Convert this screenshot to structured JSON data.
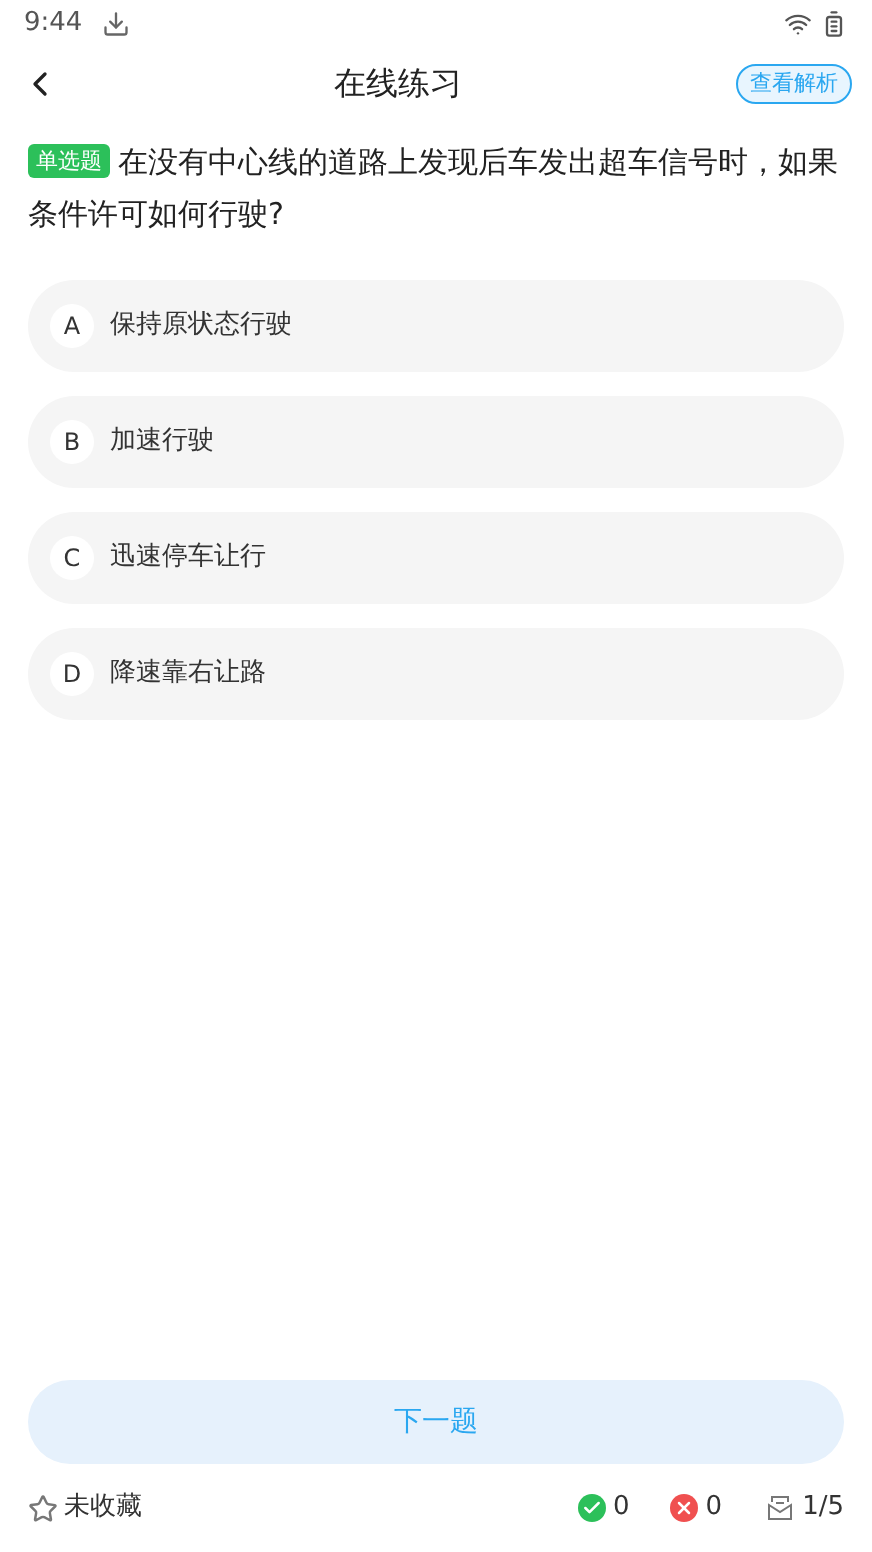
{
  "status_bar": {
    "time": "9:44"
  },
  "header": {
    "title": "在线练习",
    "action": "查看解析"
  },
  "question": {
    "type_tag": "单选题",
    "text": "在没有中心线的道路上发现后车发出超车信号时，如果条件许可如何行驶?"
  },
  "options": [
    {
      "letter": "A",
      "text": "保持原状态行驶",
      "selected": false
    },
    {
      "letter": "B",
      "text": "加速行驶",
      "selected": false
    },
    {
      "letter": "C",
      "text": "迅速停车让行",
      "selected": false
    },
    {
      "letter": "D",
      "text": "降速靠右让路",
      "selected": false
    }
  ],
  "next_button": "下一题",
  "footer": {
    "favorite": {
      "label": "未收藏",
      "starred": false
    },
    "correct": "0",
    "wrong": "0",
    "progress": "1/5"
  }
}
